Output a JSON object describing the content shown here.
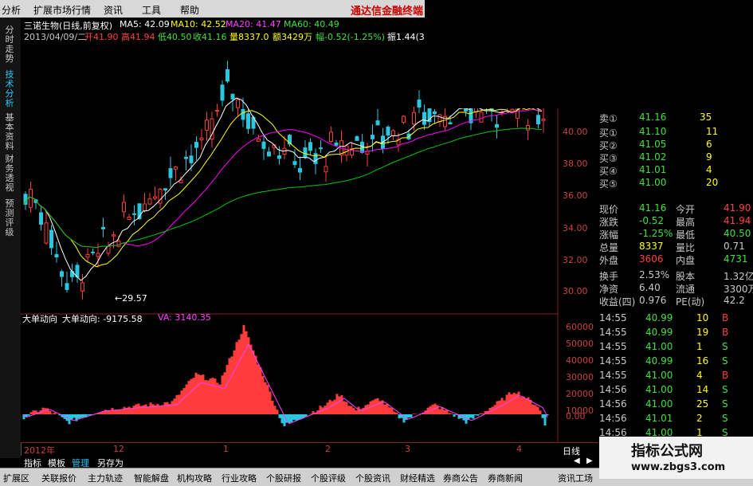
{
  "menu": {
    "items": [
      "分析",
      "扩展市场行情",
      "资讯",
      "工具",
      "帮助"
    ],
    "brand": "通达信金融终端"
  },
  "left_tabs": [
    {
      "label": "分时走势",
      "active": false
    },
    {
      "label": "技术分析",
      "active": true
    },
    {
      "label": "基本资料",
      "active": false
    },
    {
      "label": "财务透视",
      "active": false
    },
    {
      "label": "预测评级",
      "active": false
    }
  ],
  "header": {
    "stock": "三诺生物(日线,前复权)",
    "ma5": "MA5: 42.09",
    "ma10": "MA10: 42.52",
    "ma20": "MA20: 41.47",
    "ma60": "MA60: 40.49",
    "date": "2013/04/09/二",
    "open": "开41.90",
    "high": "高41.94",
    "low": "低40.50",
    "close": "收41.16",
    "vol": "量8337.0",
    "amount": "额3429万",
    "change": "幅-0.52(-1.25%)",
    "amp": "振1.44(3."
  },
  "price_axis": [
    "40.00",
    "38.00",
    "36.00",
    "34.00",
    "32.00",
    "30.00"
  ],
  "low_marker": "←29.57",
  "indicator": {
    "name": "大单动向",
    "value": "大单动向: -9175.58",
    "va": "VA: 3140.35",
    "axis": [
      "60000",
      "50000",
      "40000",
      "30000",
      "20000",
      "10000",
      "0.00"
    ]
  },
  "x_axis": [
    "2012年",
    "12",
    "1",
    "2",
    "3",
    "4"
  ],
  "quotes": {
    "sell1": {
      "label": "卖①",
      "price": "41.16",
      "vol": "35"
    },
    "buy": [
      {
        "label": "买①",
        "price": "41.10",
        "vol": "11"
      },
      {
        "label": "买②",
        "price": "41.05",
        "vol": "6"
      },
      {
        "label": "买③",
        "price": "41.02",
        "vol": "9"
      },
      {
        "label": "买④",
        "price": "41.01",
        "vol": "4"
      },
      {
        "label": "买⑤",
        "price": "41.00",
        "vol": "20"
      }
    ],
    "stats": [
      {
        "l1": "现价",
        "v1": "41.16",
        "l2": "今开",
        "v2": "41.90"
      },
      {
        "l1": "涨跌",
        "v1": "-0.52",
        "l2": "最高",
        "v2": "41.94"
      },
      {
        "l1": "涨幅",
        "v1": "-1.25%",
        "l2": "最低",
        "v2": "40.50"
      },
      {
        "l1": "总量",
        "v1": "8337",
        "l2": "量比",
        "v2": "0.71"
      },
      {
        "l1": "外盘",
        "v1": "3606",
        "l2": "内盘",
        "v2": "4731"
      },
      {
        "l1": "换手",
        "v1": "2.53%",
        "l2": "股本",
        "v2": "1.32亿"
      },
      {
        "l1": "净资",
        "v1": "6.40",
        "l2": "流通",
        "v2": "3300万"
      },
      {
        "l1": "收益(四)",
        "v1": "0.976",
        "l2": "PE(动)",
        "v2": "42.2"
      }
    ],
    "ticks": [
      {
        "t": "14:55",
        "p": "40.99",
        "v": "10",
        "s": "B"
      },
      {
        "t": "14:55",
        "p": "40.99",
        "v": "19",
        "s": "B"
      },
      {
        "t": "14:55",
        "p": "41.00",
        "v": "1",
        "s": "S"
      },
      {
        "t": "14:55",
        "p": "40.99",
        "v": "16",
        "s": "S"
      },
      {
        "t": "14:55",
        "p": "41.00",
        "v": "4",
        "s": "B"
      },
      {
        "t": "14:56",
        "p": "41.00",
        "v": "14",
        "s": "S"
      },
      {
        "t": "14:56",
        "p": "41.00",
        "v": "25",
        "s": "S"
      },
      {
        "t": "14:56",
        "p": "41.01",
        "v": "2",
        "s": "S"
      },
      {
        "t": "14:56",
        "p": "41.00",
        "v": "1",
        "s": "S"
      }
    ]
  },
  "bottom_tabs": [
    "指标",
    "模板",
    "管理",
    "另存为"
  ],
  "right_bottom": [
    "日线",
    "◀",
    "▶"
  ],
  "toolbar": [
    "扩展区",
    "关联报价",
    "主力轨迹",
    "智能解盘",
    "机构攻略",
    "行业攻略",
    "个股研报",
    "个股评级",
    "个股资讯",
    "财经精选",
    "券商公告",
    "券商新闻",
    "资讯工场"
  ],
  "watermark": {
    "title": "指标公式网",
    "url": "www.zbgs3.com"
  },
  "colors": {
    "up": "#ff3c3c",
    "down": "#28c8e0",
    "ma5": "#ffffff",
    "ma10": "#ffff00",
    "ma20": "#ff00ff",
    "ma60": "#00c800"
  }
}
